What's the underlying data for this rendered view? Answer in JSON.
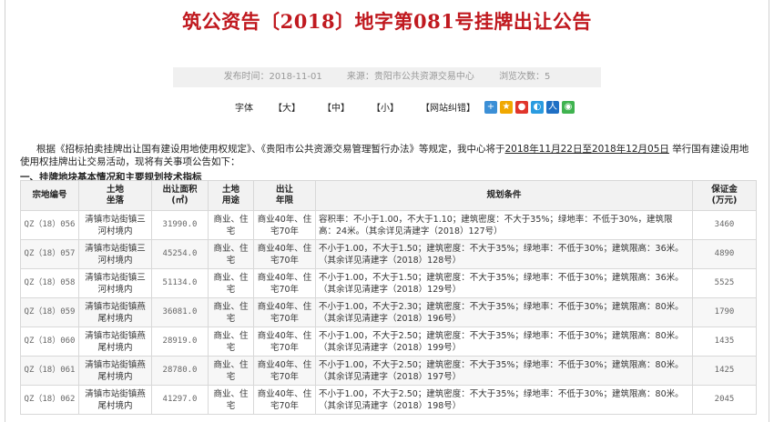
{
  "page": {
    "title": "筑公资告〔2018〕地字第081号挂牌出让公告",
    "meta": {
      "publish_time": "发布时间：2018-11-01",
      "source": "来源：贵阳市公共资源交易中心",
      "views": "浏览次数：5"
    },
    "toolbar": {
      "font_label": "字体",
      "large": "【大】",
      "medium": "【中】",
      "small": "【小】",
      "report": "【网站纠错】"
    },
    "share_icons": [
      "qzone-icon",
      "kaixin-icon",
      "weibo-icon",
      "tqq-icon",
      "renren-icon",
      "wechat-icon"
    ],
    "intro": {
      "before": "根据《招标拍卖挂牌出让国有建设用地使用权规定》、《贵阳市公共资源交易管理暂行办法》等规定，我中心将于",
      "start_date": "2018年11月22日",
      "mid": "至",
      "end_date": "2018年12月05日",
      "after": " 举行国有建设用地使用权挂牌出让交易活动，现将有关事项公告如下："
    },
    "section_title": "一、挂牌地块基本情况和主要规划技术指标"
  },
  "table": {
    "headers": [
      "宗地编号",
      "土地\n坐落",
      "出让面积\n(㎡)",
      "土地\n用途",
      "出让\n年限",
      "规划条件",
      "保证金\n(万元)"
    ],
    "rows": [
      [
        "QZ（18）056",
        "清镇市站街镇三河村境内",
        "31990.0",
        "商业、住宅",
        "商业40年、住宅70年",
        "容积率：不小于1.00，不大于1.10；建筑密度：不大于35%；绿地率：不低于30%，建筑限高：24米。（其余详见清建字（2018）127号）",
        "3460"
      ],
      [
        "QZ（18）057",
        "清镇市站街镇三河村境内",
        "45254.0",
        "商业、住宅",
        "商业40年、住宅70年",
        "不小于1.00，不大于1.50；建筑密度：不大于35%；绿地率：不低于30%；建筑限高：36米。（其余详见清建字（2018）128号）",
        "4890"
      ],
      [
        "QZ（18）058",
        "清镇市站街镇三河村境内",
        "51134.0",
        "商业、住宅",
        "商业40年、住宅70年",
        "不小于1.00，不大于1.50；建筑密度：不大于35%；绿地率：不低于30%；建筑限高：36米。（其余详见清建字（2018）129号）",
        "5525"
      ],
      [
        "QZ（18）059",
        "清镇市站街镇燕尾村境内",
        "36081.0",
        "商业、住宅",
        "商业40年、住宅70年",
        "不小于1.00，不大于2.30；建筑密度：不大于35%；绿地率：不低于30%；建筑限高：80米。（其余详见清建字（2018）196号）",
        "1790"
      ],
      [
        "QZ（18）060",
        "清镇市站街镇燕尾村境内",
        "28919.0",
        "商业、住宅",
        "商业40年、住宅70年",
        "不小于1.00，不大于2.50；建筑密度：不大于35%；绿地率：不低于30%；建筑限高：80米。（其余详见清建字（2018）199号）",
        "1435"
      ],
      [
        "QZ（18）061",
        "清镇市站街镇燕尾村境内",
        "28780.0",
        "商业、住宅",
        "商业40年、住宅70年",
        "不小于1.00，不大于2.50；建筑密度：不大于35%；绿地率：不低于30%；建筑限高：80米。（其余详见清建字（2018）197号）",
        "1425"
      ],
      [
        "QZ（18）062",
        "清镇市站街镇燕尾村境内",
        "41297.0",
        "商业、住宅",
        "商业40年、住宅70年",
        "不小于1.00，不大于2.50；建筑密度：不大于35%；绿地率：不低于30%；建筑限高：80米。（其余详见清建字（2018）198号）",
        "2045"
      ]
    ]
  },
  "colors": {
    "title": "#c0191f",
    "meta_bg": "#f0f0f0",
    "border": "#d8d8d8"
  }
}
